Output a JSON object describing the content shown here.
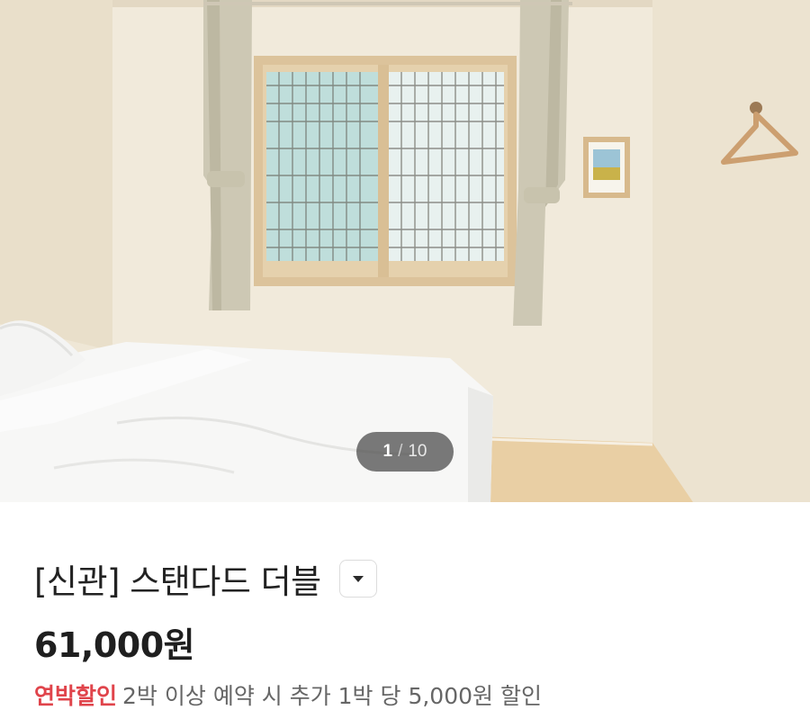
{
  "gallery": {
    "current": "1",
    "separator": "/",
    "total": "10"
  },
  "room": {
    "title": "[신관] 스탠다드 더블",
    "expand_icon": "caret-down-icon",
    "price": "61,000원"
  },
  "promo": {
    "tag": "연박할인",
    "text": "2박 이상 예약 시 추가 1박 당 5,000원 할인",
    "tag_color": "#e0444b"
  }
}
